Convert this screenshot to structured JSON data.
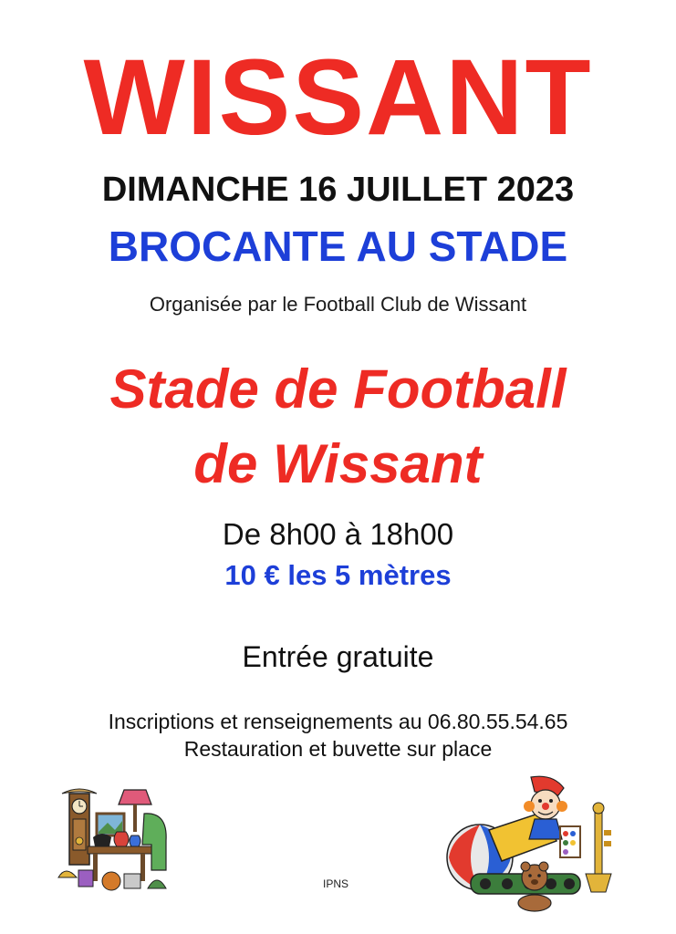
{
  "poster": {
    "title": "WISSANT",
    "date": "DIMANCHE 16 JUILLET 2023",
    "event": "BROCANTE AU STADE",
    "organiser": "Organisée par le Football Club de Wissant",
    "venue_line1": "Stade de Football",
    "venue_line2": "de Wissant",
    "hours": "De 8h00 à 18h00",
    "price": "10 € les 5 mètres",
    "entry": "Entrée gratuite",
    "info_line1": "Inscriptions et renseignements au 06.80.55.54.65",
    "info_line2": "Restauration et buvette sur place",
    "footer": "IPNS"
  },
  "illustrations": {
    "left": "antiques-clipart-icon",
    "right": "toys-clipart-icon"
  },
  "colors": {
    "title_red": "#ee2b24",
    "event_blue": "#1d3fd8",
    "text_black": "#111111",
    "background": "#ffffff"
  }
}
